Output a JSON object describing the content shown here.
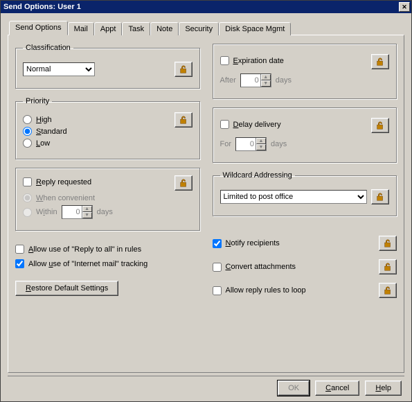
{
  "window": {
    "title": "Send Options: User 1"
  },
  "tabs": [
    "Send Options",
    "Mail",
    "Appt",
    "Task",
    "Note",
    "Security",
    "Disk Space Mgmt"
  ],
  "classification": {
    "legend": "Classification",
    "value": "Normal"
  },
  "priority": {
    "legend": "Priority",
    "options": {
      "high": "High",
      "standard": "Standard",
      "low": "Low"
    },
    "high_acc": "H",
    "standard_acc": "S",
    "low_acc": "L",
    "selected": "standard"
  },
  "reply": {
    "label": "Reply requested",
    "acc": "R",
    "when_label": "When convenient",
    "within_label": "Within",
    "within_value": "0",
    "days_label": "days"
  },
  "rules_reply_all": {
    "label": "Allow use of \"Reply to all\" in rules",
    "acc": "A",
    "checked": false
  },
  "internet_track": {
    "label": "Allow use of \"Internet mail\" tracking",
    "acc": "u",
    "checked": true
  },
  "restore": {
    "label": "Restore Default Settings",
    "acc": "R"
  },
  "expiration": {
    "label": "Expiration date",
    "acc": "E",
    "after": "After",
    "value": "0",
    "days": "days"
  },
  "delay": {
    "label": "Delay delivery",
    "acc": "D",
    "for": "For",
    "value": "0",
    "days": "days"
  },
  "wildcard": {
    "legend": "Wildcard Addressing",
    "value": "Limited to post office"
  },
  "notify": {
    "label": "Notify recipients",
    "acc": "N",
    "checked": true
  },
  "convert": {
    "label": "Convert attachments",
    "acc": "C",
    "checked": false
  },
  "looprules": {
    "label": "Allow reply rules to loop",
    "checked": false
  },
  "buttons": {
    "ok": "OK",
    "cancel": "Cancel",
    "help": "Help"
  }
}
